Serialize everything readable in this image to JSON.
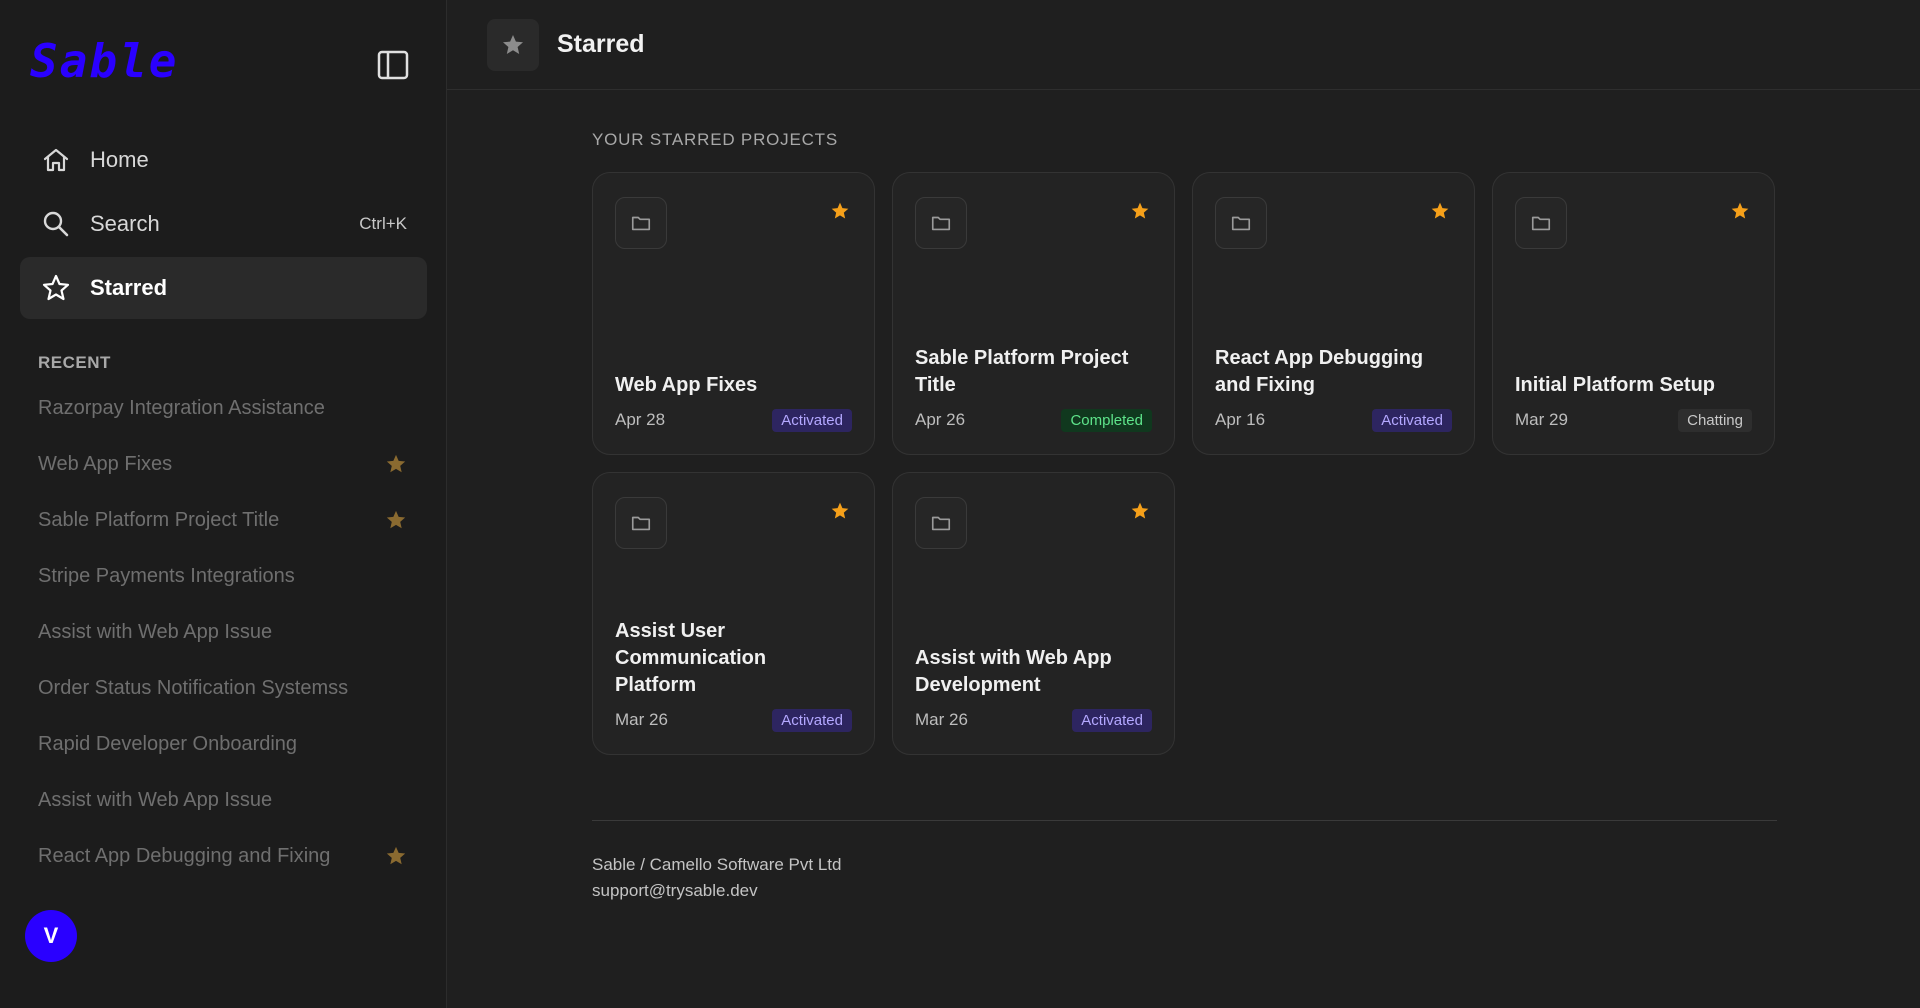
{
  "sidebar": {
    "brand": "Sable",
    "nav": [
      {
        "label": "Home",
        "icon": "home-icon",
        "shortcut": ""
      },
      {
        "label": "Search",
        "icon": "search-icon",
        "shortcut": "Ctrl+K"
      },
      {
        "label": "Starred",
        "icon": "star-outline-icon",
        "shortcut": ""
      }
    ],
    "recent_title": "RECENT",
    "recent": [
      {
        "label": "Razorpay Integration Assistance",
        "starred": false
      },
      {
        "label": "Web App Fixes",
        "starred": true
      },
      {
        "label": "Sable Platform Project Title",
        "starred": true
      },
      {
        "label": "Stripe Payments Integrations",
        "starred": false
      },
      {
        "label": "Assist with Web App Issue",
        "starred": false
      },
      {
        "label": "Order Status Notification Systemss",
        "starred": false
      },
      {
        "label": "Rapid Developer Onboarding",
        "starred": false
      },
      {
        "label": "Assist with Web App Issue",
        "starred": false
      },
      {
        "label": "React App Debugging and Fixing",
        "starred": true
      }
    ],
    "avatar_initial": "V"
  },
  "header": {
    "title": "Starred"
  },
  "main": {
    "section_title": "YOUR STARRED PROJECTS",
    "cards": [
      {
        "title": "Web App Fixes",
        "date": "Apr 28",
        "status": "Activated"
      },
      {
        "title": "Sable Platform Project Title",
        "date": "Apr 26",
        "status": "Completed"
      },
      {
        "title": "React App Debugging and Fixing",
        "date": "Apr 16",
        "status": "Activated"
      },
      {
        "title": "Initial Platform Setup",
        "date": "Mar 29",
        "status": "Chatting"
      },
      {
        "title": "Assist User Communication Platform",
        "date": "Mar 26",
        "status": "Activated"
      },
      {
        "title": "Assist with Web App Development",
        "date": "Mar 26",
        "status": "Activated"
      }
    ]
  },
  "footer": {
    "company": "Sable / Camello Software Pvt Ltd",
    "email": "support@trysable.dev"
  },
  "colors": {
    "brand": "#2a00ff",
    "star": "#f5a01a",
    "star_muted": "#8a6a30",
    "activated_bg": "#2d2560",
    "completed_bg": "#10381e"
  }
}
